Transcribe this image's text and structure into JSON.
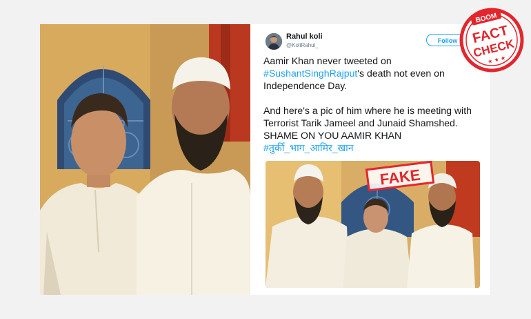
{
  "tweet": {
    "user_name": "Rahul koli",
    "handle": "@KoliRahul_",
    "follow_label": "Follow",
    "line1_text": "Aamir Khan never tweeted on",
    "hashtag1": "#SushantSinghRajput",
    "line2_rest": "'s death not even on",
    "line3_text": "Independence Day.",
    "para2_text": "And here's a pic of him where he is meeting with Terrorist Tarik Jameel and Junaid Shamshed. SHAME ON YOU AAMIR KHAN",
    "hashtag2": "#तुर्की_भाग_आमिर_खान"
  },
  "stamps": {
    "fake_label": "FAKE",
    "badge_top": "BOOM",
    "badge_line1": "FACT",
    "badge_line2": "CHECK",
    "badge_stars": "★ ★ ★"
  },
  "colors": {
    "link": "#1da1f2",
    "stamp_red": "#e3262d"
  }
}
